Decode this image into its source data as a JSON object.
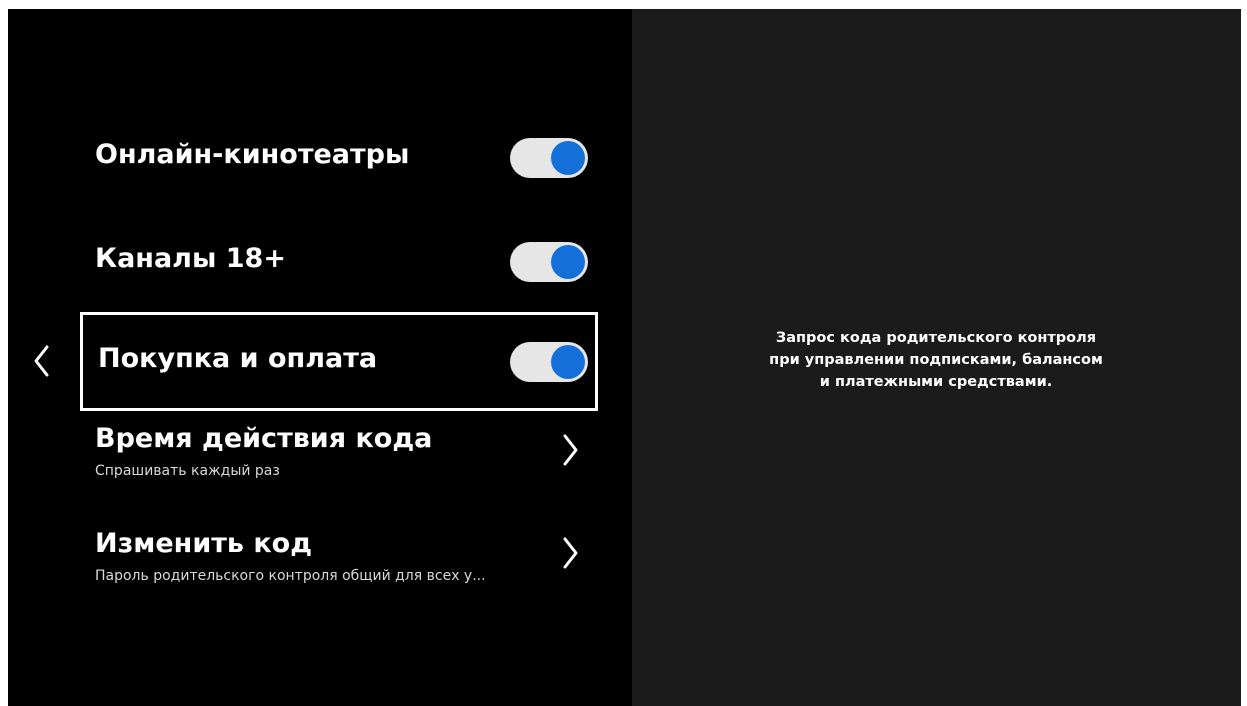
{
  "settings": {
    "items": [
      {
        "label": "Онлайн-кинотеатры",
        "toggle_on": true
      },
      {
        "label": "Каналы 18+",
        "toggle_on": true
      },
      {
        "label": "Покупка и оплата",
        "toggle_on": true,
        "focused": true
      }
    ],
    "nav_items": [
      {
        "label": "Время действия кода",
        "subtitle": "Спрашивать каждый раз"
      },
      {
        "label": "Изменить код",
        "subtitle": "Пароль родительского контроля общий для всех у..."
      }
    ]
  },
  "description": {
    "lines": [
      "Запрос кода родительского контроля",
      "при управлении подписками, балансом",
      "и платежными средствами."
    ]
  },
  "colors": {
    "toggle_knob": "#1470d8",
    "toggle_track": "#e6e6e6",
    "left_bg": "#000000",
    "right_bg": "#1b1b1b"
  },
  "icons": {
    "back": "chevron-left-icon",
    "nav": "chevron-right-icon"
  }
}
